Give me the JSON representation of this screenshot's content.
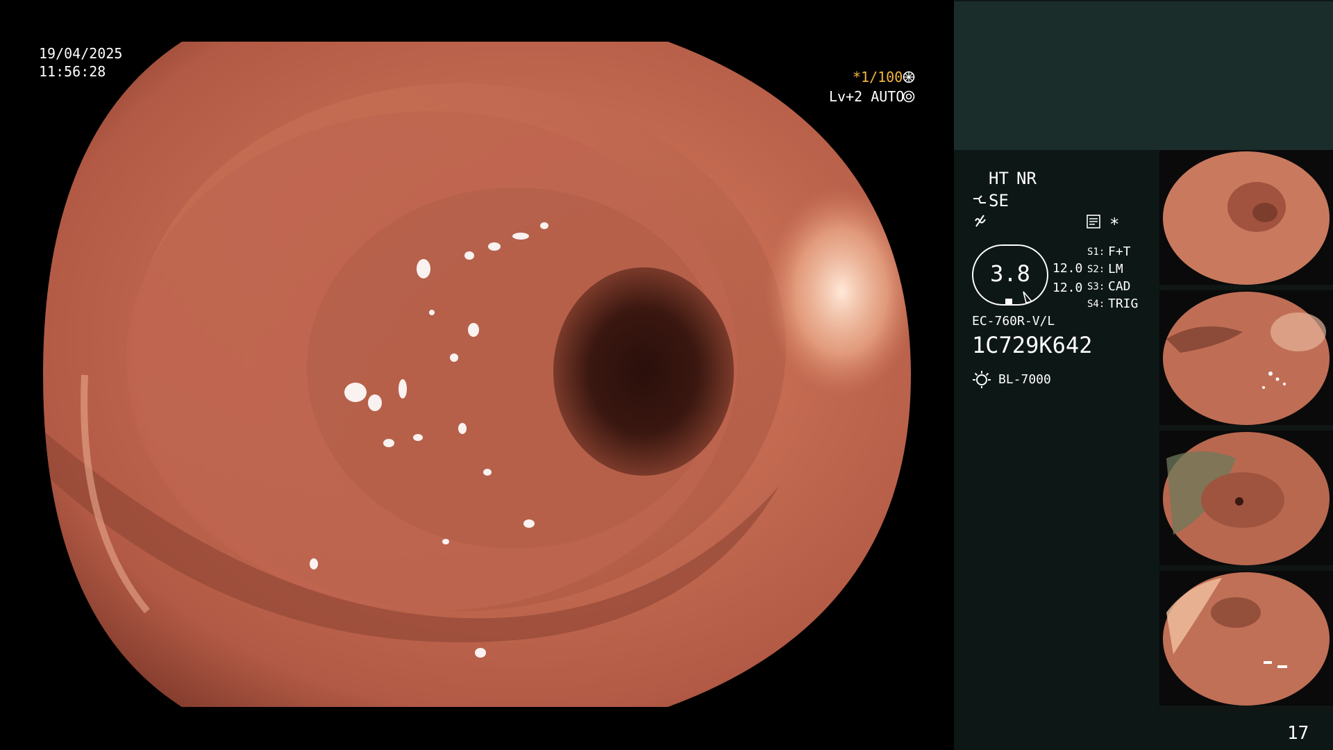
{
  "osd": {
    "date": "19/04/2025",
    "time": "11:56:28",
    "shutter": "*1/100",
    "level": "Lv+2 AUTO"
  },
  "panel": {
    "ht": "HT",
    "nr": "NR",
    "se": "SE",
    "zoom": "3.8",
    "value_a": "12.0",
    "value_b": "12.0",
    "asterisk": "*",
    "s1_key": "S1:",
    "s1_val": "F+T",
    "s2_key": "S2:",
    "s2_val": "LM",
    "s3_key": "S3:",
    "s3_val": "CAD",
    "s4_key": "S4:",
    "s4_val": "TRIG",
    "scope_model": "EC-760R-V/L",
    "serial": "1C729K642",
    "light_source": "BL-7000"
  },
  "page_number": "17",
  "colors": {
    "accent_yellow": "#f4b63c",
    "panel_bg": "#0d1715",
    "panel_header_bg": "#1b2d2b",
    "mucosa": "#c46a50"
  },
  "icons": [
    "aperture-icon",
    "iris-icon",
    "structure-enhance-icon",
    "filter-icon",
    "memo-icon",
    "light-source-icon"
  ]
}
